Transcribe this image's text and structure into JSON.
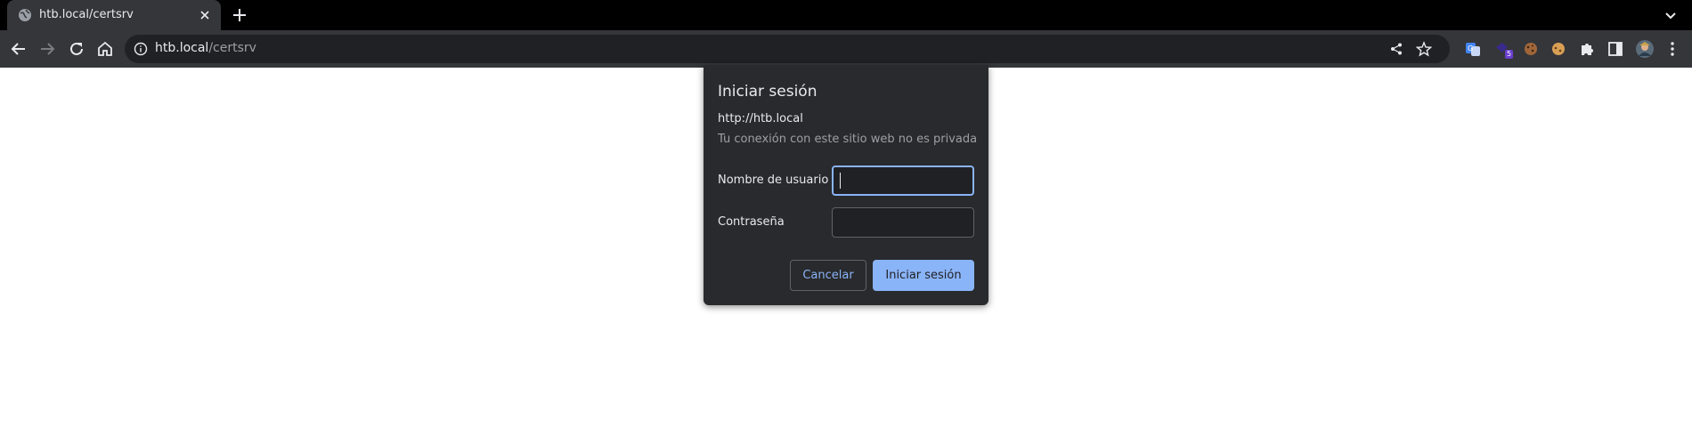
{
  "browser": {
    "tab": {
      "title": "htb.local/certsrv"
    },
    "address": {
      "host": "htb.local",
      "path": "/certsrv"
    },
    "extensions": [
      {
        "name": "translate-extension-icon"
      },
      {
        "name": "extension-badge-icon",
        "badge": "5"
      },
      {
        "name": "cookie-extension-icon"
      },
      {
        "name": "cookie-editor-extension-icon"
      }
    ]
  },
  "dialog": {
    "title": "Iniciar sesión",
    "origin": "http://htb.local",
    "warning": "Tu conexión con este sitio web no es privada",
    "username_label": "Nombre de usuario",
    "username_value": "",
    "password_label": "Contraseña",
    "password_value": "",
    "cancel_label": "Cancelar",
    "signin_label": "Iniciar sesión"
  },
  "colors": {
    "accent": "#8ab4f8",
    "dialog_bg": "#292a2d",
    "toolbar_bg": "#35363a"
  }
}
